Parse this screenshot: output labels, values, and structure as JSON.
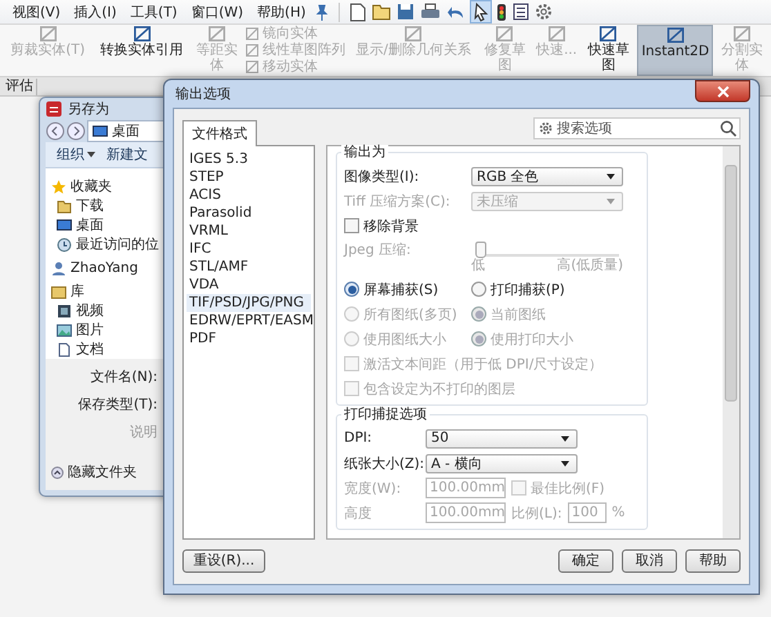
{
  "menu_bar": {
    "menus": [
      "视图(V)",
      "插入(I)",
      "工具(T)",
      "窗口(W)",
      "帮助(H)"
    ]
  },
  "ribbon": {
    "items": [
      {
        "kind": "large",
        "label": "剪裁实体(T)",
        "disabled": true,
        "selected": false
      },
      {
        "kind": "large",
        "label": "转换实体引用",
        "disabled": false,
        "selected": false
      },
      {
        "kind": "large",
        "label": "等距实体",
        "disabled": true,
        "selected": false
      },
      {
        "kind": "stack",
        "selected": false,
        "entries": [
          {
            "label": "镜向实体",
            "disabled": true
          },
          {
            "label": "线性草图阵列",
            "disabled": true
          },
          {
            "label": "移动实体",
            "disabled": true
          }
        ]
      },
      {
        "kind": "large",
        "label": "显示/删除几何关系",
        "disabled": true,
        "selected": false
      },
      {
        "kind": "large",
        "label": "修复草图",
        "disabled": true,
        "selected": false
      },
      {
        "kind": "large",
        "label": "快速...",
        "disabled": true,
        "selected": false
      },
      {
        "kind": "large",
        "label": "快速草图",
        "disabled": false,
        "selected": false
      },
      {
        "kind": "large",
        "label": "Instant2D",
        "disabled": false,
        "selected": true
      },
      {
        "kind": "large",
        "label": "分割实体",
        "disabled": true,
        "selected": false
      }
    ]
  },
  "tabs": [
    {
      "label": "评估"
    }
  ],
  "save_as_window": {
    "title": "另存为",
    "location": "桌面",
    "toolbar": [
      "组织",
      "新建文"
    ],
    "nav": [
      {
        "label": "收藏夹",
        "children": [
          {
            "label": "下载"
          },
          {
            "label": "桌面"
          },
          {
            "label": "最近访问的位"
          }
        ]
      },
      {
        "label": "ZhaoYang"
      },
      {
        "label": "库",
        "children": [
          {
            "label": "视频"
          },
          {
            "label": "图片"
          },
          {
            "label": "文档"
          }
        ]
      }
    ],
    "fields": [
      "文件名(N):",
      "保存类型(T):",
      "说明"
    ],
    "hide_folders": "隐藏文件夹"
  },
  "dialog": {
    "title": "输出选项",
    "tab": "文件格式",
    "search": {
      "placeholder": "搜索选项"
    },
    "formats": [
      {
        "label": "IGES 5.3",
        "selected": false
      },
      {
        "label": "STEP",
        "selected": false
      },
      {
        "label": "ACIS",
        "selected": false
      },
      {
        "label": "Parasolid",
        "selected": false
      },
      {
        "label": "VRML",
        "selected": false
      },
      {
        "label": "IFC",
        "selected": false
      },
      {
        "label": "STL/AMF",
        "selected": false
      },
      {
        "label": "VDA",
        "selected": false
      },
      {
        "label": "TIF/PSD/JPG/PNG",
        "selected": true
      },
      {
        "label": "EDRW/EPRT/EASM",
        "selected": false
      },
      {
        "label": "PDF",
        "selected": false
      }
    ],
    "groups": [
      {
        "title": "输出为",
        "controls": [
          {
            "kind": "dropdown",
            "label": "图像类型(I):",
            "value": "RGB 全色",
            "disabled": false
          },
          {
            "kind": "dropdown",
            "label": "Tiff 压缩方案(C):",
            "value": "未压缩",
            "disabled": true
          },
          {
            "kind": "checkbox",
            "label": "移除背景",
            "checked": false,
            "disabled": false
          },
          {
            "kind": "slider",
            "label": "Jpeg 压缩:",
            "level": 0,
            "min_label": "低",
            "max_label": "高(低质量)",
            "disabled": true
          },
          {
            "kind": "radio_row",
            "options": [
              {
                "label": "屏幕捕获(S)",
                "selected": true,
                "disabled": false
              },
              {
                "label": "打印捕获(P)",
                "selected": false,
                "disabled": false
              }
            ]
          },
          {
            "kind": "radio_row",
            "options": [
              {
                "label": "所有图纸(多页)",
                "selected": false,
                "disabled": true
              },
              {
                "label": "当前图纸",
                "selected": true,
                "disabled": true
              }
            ]
          },
          {
            "kind": "radio_row",
            "options": [
              {
                "label": "使用图纸大小",
                "selected": false,
                "disabled": true
              },
              {
                "label": "使用打印大小",
                "selected": true,
                "disabled": true
              }
            ]
          },
          {
            "kind": "checkbox",
            "label": "激活文本间距（用于低 DPI/尺寸设定）",
            "checked": false,
            "disabled": true
          },
          {
            "kind": "checkbox",
            "label": "包含设定为不打印的图层",
            "checked": false,
            "disabled": true
          }
        ]
      },
      {
        "title": "打印捕捉选项",
        "controls": [
          {
            "kind": "dropdown",
            "label": "DPI:",
            "value": "50",
            "disabled": false
          },
          {
            "kind": "dropdown",
            "label": "纸张大小(Z):",
            "value": "A - 横向",
            "disabled": false
          },
          {
            "kind": "field_row",
            "label": "宽度(W):",
            "value": "100.00mm",
            "disabled": true,
            "extra": {
              "kind": "checkbox",
              "label": "最佳比例(F)",
              "checked": false,
              "disabled": true
            }
          },
          {
            "kind": "field_row",
            "label": "高度",
            "value": "100.00mm",
            "disabled": true,
            "extra": {
              "kind": "field",
              "label": "比例(L):",
              "value": "100",
              "unit": "%",
              "disabled": true
            }
          }
        ]
      }
    ],
    "reset": "重设(R)...",
    "buttons": [
      "确定",
      "取消",
      "帮助"
    ]
  }
}
